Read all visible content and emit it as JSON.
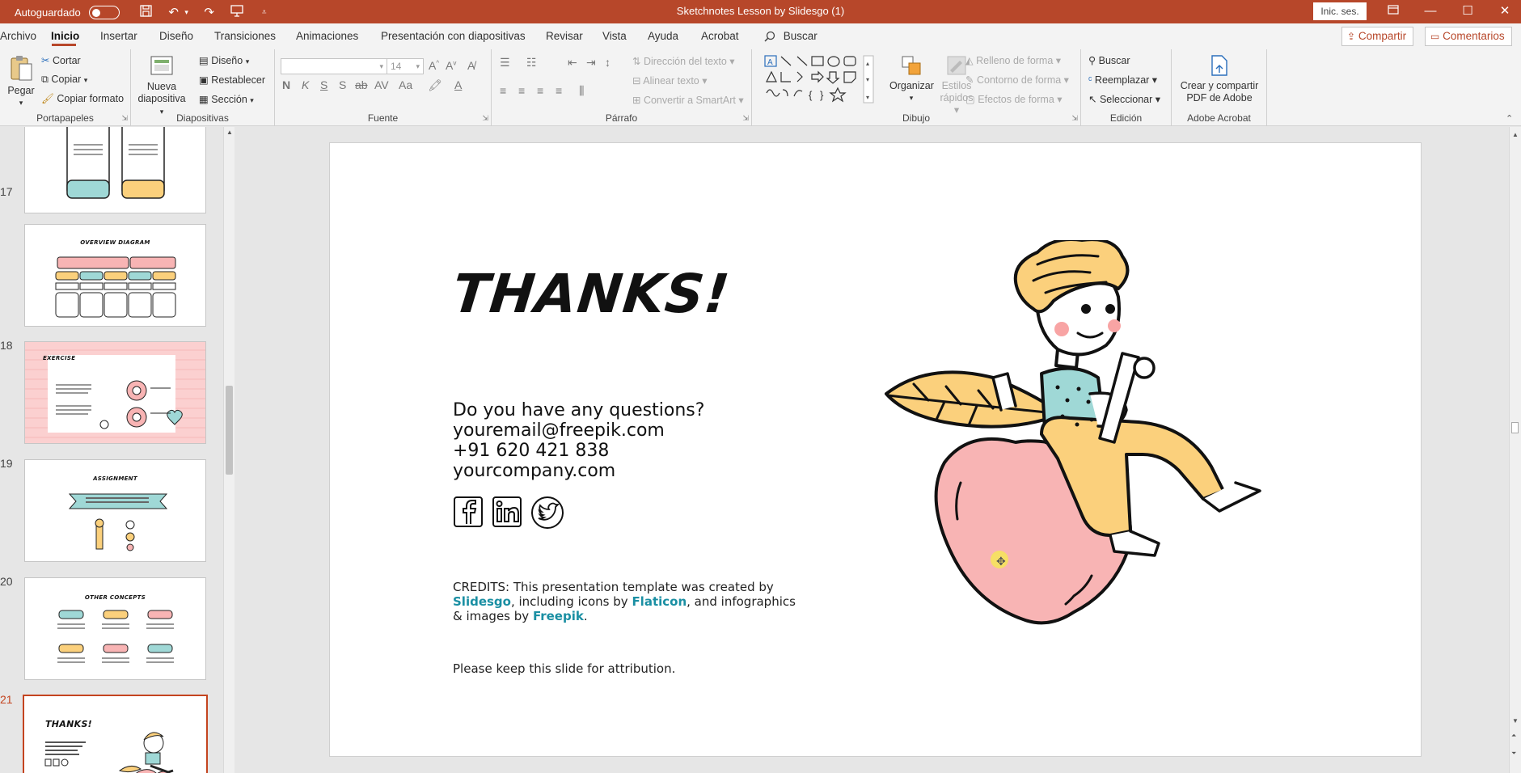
{
  "titlebar": {
    "autosave_label": "Autoguardado",
    "document_title": "Sketchnotes Lesson by Slidesgo (1)",
    "signin_label": "Inic. ses.",
    "colors": {
      "accent": "#b7472a"
    }
  },
  "menu": {
    "tabs": [
      "Archivo",
      "Inicio",
      "Insertar",
      "Diseño",
      "Transiciones",
      "Animaciones",
      "Presentación con diapositivas",
      "Revisar",
      "Vista",
      "Ayuda",
      "Acrobat"
    ],
    "active_tab": "Inicio",
    "search_label": "Buscar",
    "share_label": "Compartir",
    "comments_label": "Comentarios"
  },
  "ribbon": {
    "clipboard": {
      "paste": "Pegar",
      "cut": "Cortar",
      "copy": "Copiar",
      "format_painter": "Copiar formato",
      "label": "Portapapeles"
    },
    "slides": {
      "new_slide_line1": "Nueva",
      "new_slide_line2": "diapositiva",
      "layout": "Diseño",
      "reset": "Restablecer",
      "section": "Sección",
      "label": "Diapositivas"
    },
    "font": {
      "font_size": "14",
      "label": "Fuente"
    },
    "paragraph": {
      "text_direction": "Dirección del texto",
      "align_text": "Alinear texto",
      "smartart": "Convertir a SmartArt",
      "label": "Párrafo"
    },
    "drawing": {
      "arrange": "Organizar",
      "quick_styles_line1": "Estilos",
      "quick_styles_line2": "rápidos",
      "shape_fill": "Relleno de forma",
      "shape_outline": "Contorno de forma",
      "shape_effects": "Efectos de forma",
      "label": "Dibujo"
    },
    "editing": {
      "find": "Buscar",
      "replace": "Reemplazar",
      "select": "Seleccionar",
      "label": "Edición"
    },
    "acrobat": {
      "create_line1": "Crear y compartir",
      "create_line2": "PDF de Adobe",
      "label": "Adobe Acrobat"
    }
  },
  "thumbnails": [
    {
      "number": "",
      "title": ""
    },
    {
      "number": "17",
      "title": "OVERVIEW DIAGRAM"
    },
    {
      "number": "18",
      "title": "EXERCISE"
    },
    {
      "number": "19",
      "title": "ASSIGNMENT"
    },
    {
      "number": "20",
      "title": "OTHER CONCEPTS"
    },
    {
      "number": "21",
      "title": "THANKS!"
    }
  ],
  "slide": {
    "title": "THANKS!",
    "contact_lines": [
      "Do you have any questions?",
      "youremail@freepik.com",
      "+91 620 421 838",
      "yourcompany.com"
    ],
    "credits_prefix": "CREDITS: This presentation template was created by",
    "credits_slidesgo": "Slidesgo",
    "credits_mid1": ", including icons by ",
    "credits_flaticon": "Flaticon",
    "credits_mid2": ", and infographics",
    "credits_line3_prefix": "& images by ",
    "credits_freepik": "Freepik",
    "credits_end": ".",
    "keep_note": "Please keep this slide for attribution.",
    "social_icons": [
      "facebook-icon",
      "linkedin-icon",
      "twitter-icon"
    ],
    "colors": {
      "link": "#1a8fa3",
      "pink": "#f8b4b4",
      "yellow": "#fbd07c",
      "teal": "#9fd8d6"
    }
  }
}
